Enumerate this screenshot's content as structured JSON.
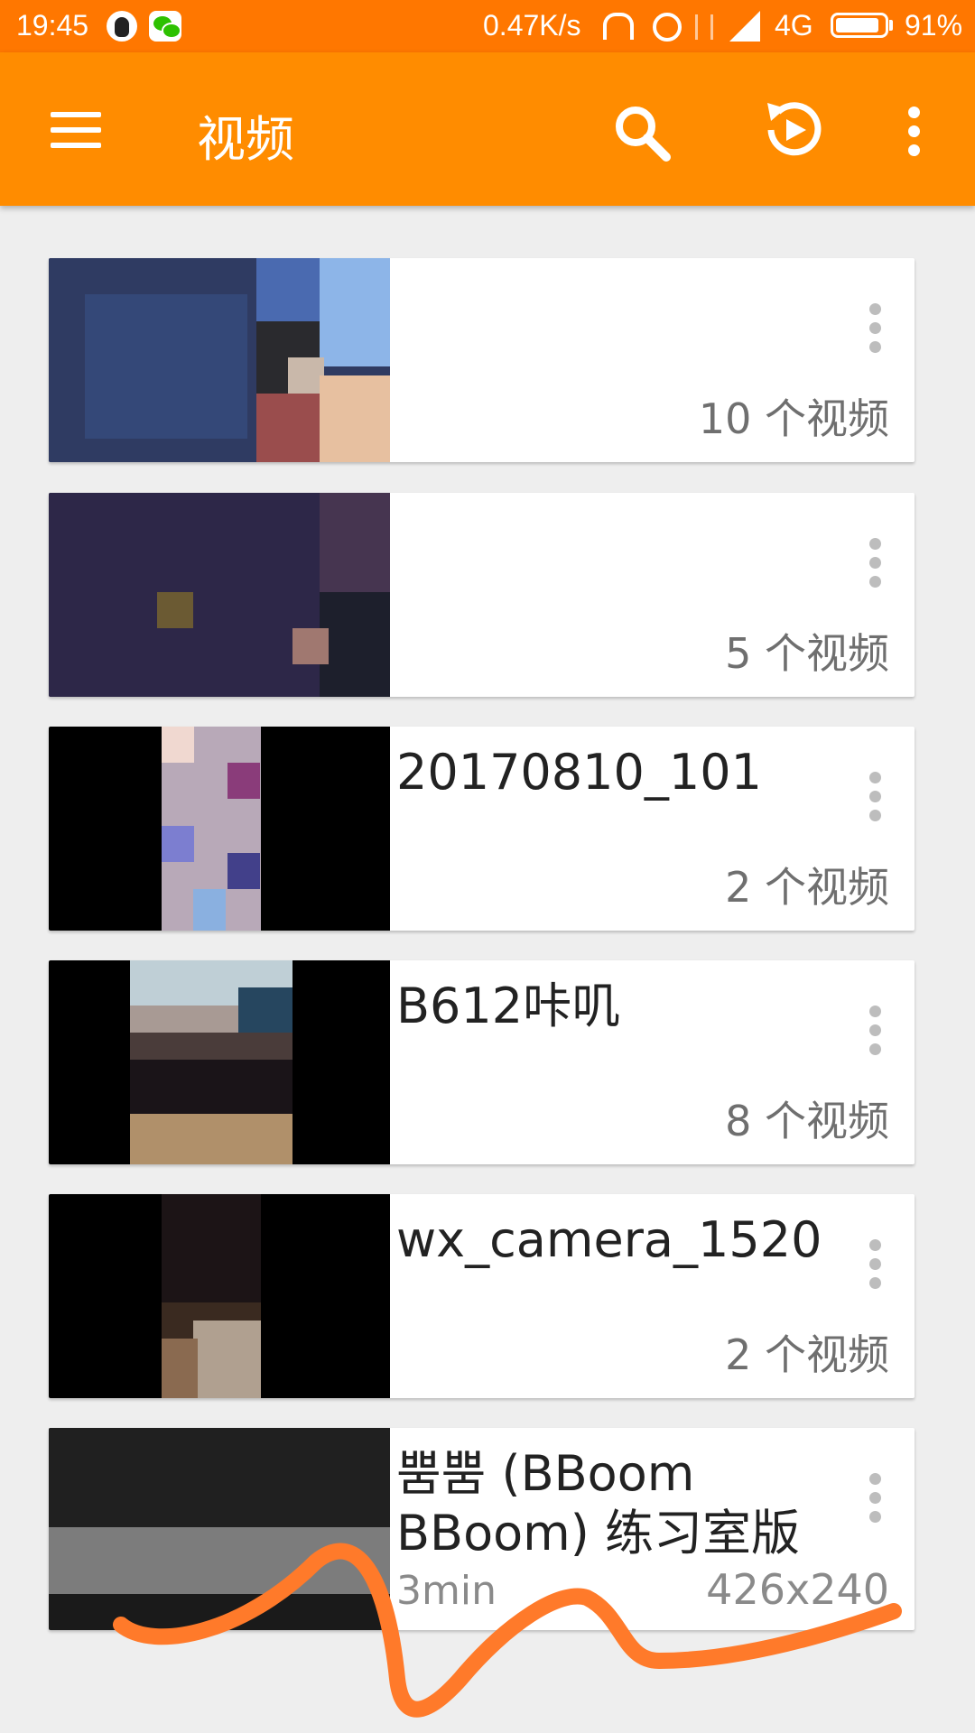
{
  "status_bar": {
    "time": "19:45",
    "net_speed": "0.47K/s",
    "network": "4G",
    "battery_percent": "91%",
    "battery_level": 0.91,
    "icons": [
      "qq-icon",
      "wechat-icon",
      "headset-icon",
      "alarm-icon",
      "data-transfer-icon",
      "signal-icon",
      "battery-icon"
    ]
  },
  "app_bar": {
    "title": "视频",
    "actions": [
      "menu-icon",
      "search-icon",
      "resume-playback-icon",
      "more-options-icon"
    ]
  },
  "folders": [
    {
      "title": "",
      "meta": "10 个视频"
    },
    {
      "title": "",
      "meta": "5 个视频"
    },
    {
      "title": "20170810_101",
      "meta": "2 个视频"
    },
    {
      "title": "B612咔叽",
      "meta": "8 个视频"
    },
    {
      "title": "wx_camera_1520",
      "meta": "2 个视频"
    },
    {
      "title": "뿜뿜 (BBoom\nBBoom) 练习室版",
      "duration": "3min",
      "resolution": "426x240"
    }
  ],
  "colors": {
    "status_bar": "#ff7700",
    "app_bar": "#ff8c00",
    "background": "#eeeeee",
    "scribble": "#ff7a2a"
  }
}
